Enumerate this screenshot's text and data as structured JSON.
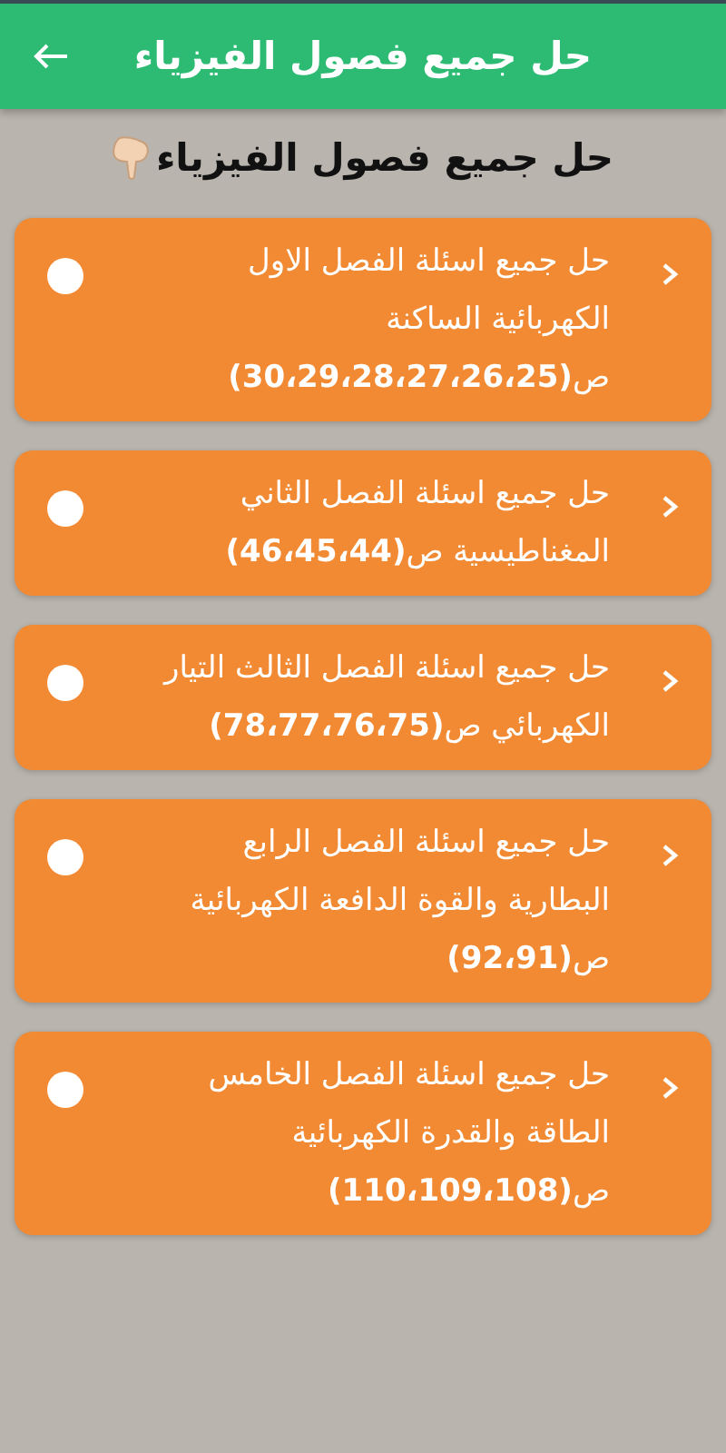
{
  "app_bar": {
    "title": "حل جميع فصول الفيزياء"
  },
  "heading": "حل جميع فصول الفيزياء",
  "chapters": [
    {
      "text": "حل جميع اسئلة الفصل الاول الكهربائية الساكنة ص**(30،29،28،27،26،25)**"
    },
    {
      "text": "حل جميع اسئلة الفصل الثاني المغناطيسية ص**(46،45،44)**"
    },
    {
      "text": "حل جميع اسئلة الفصل الثالث التيار الكهربائي ص**(78،77،76،75)**"
    },
    {
      "text": "حل جميع اسئلة الفصل الرابع البطارية والقوة الدافعة الكهربائية ص**(92،91)**"
    },
    {
      "text": "حل جميع اسئلة الفصل الخامس الطاقة والقدرة الكهربائية ص**(110،109،108)**"
    }
  ]
}
